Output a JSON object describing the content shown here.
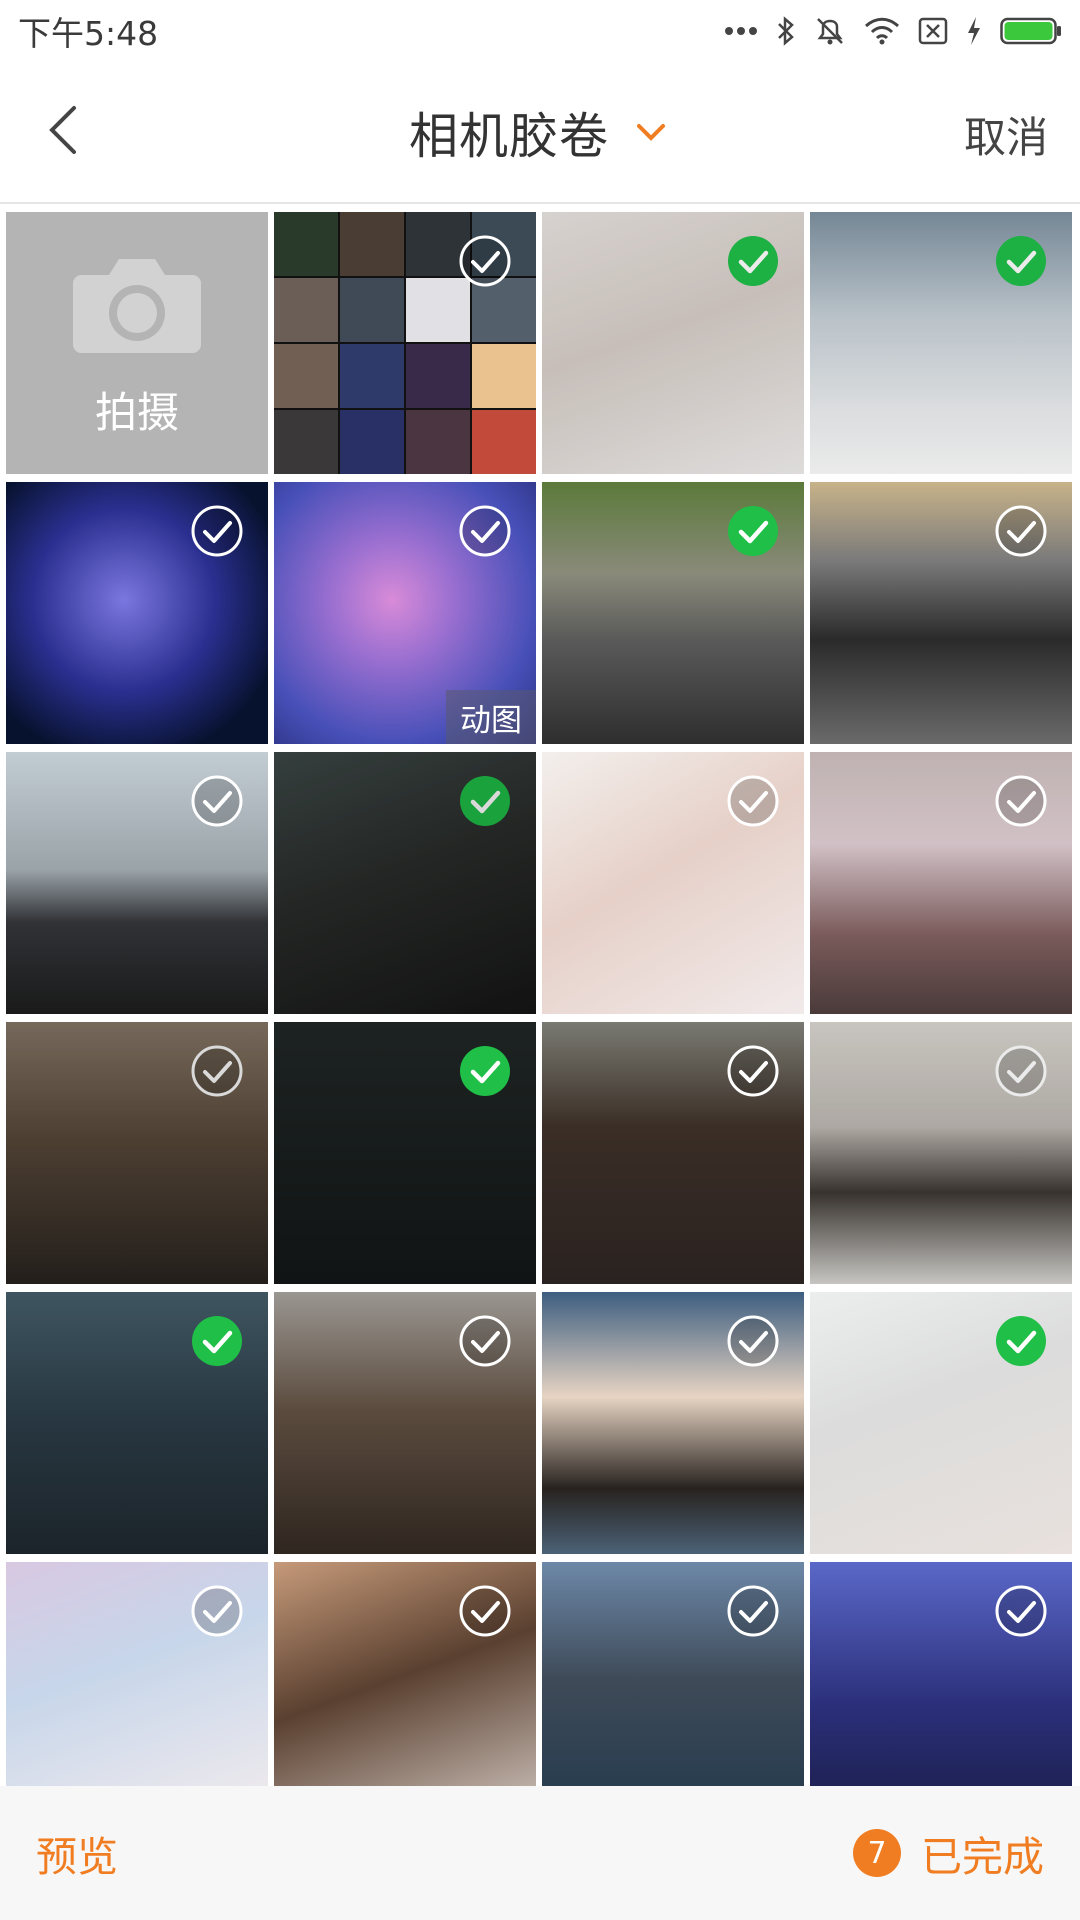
{
  "status_bar": {
    "time": "下午5:48",
    "battery_color": "#3cc83c"
  },
  "header": {
    "title": "相机胶卷",
    "cancel_label": "取消",
    "accent_color": "#f07d22"
  },
  "camera_tile": {
    "label": "拍摄",
    "icon": "camera-icon"
  },
  "photos": [
    {
      "checked": false,
      "collage": true,
      "gif": ""
    },
    {
      "checked": true,
      "gif": ""
    },
    {
      "checked": true,
      "gif": ""
    },
    {
      "checked": false,
      "gif": ""
    },
    {
      "checked": false,
      "gif": "动图"
    },
    {
      "checked": true,
      "gif": ""
    },
    {
      "checked": false,
      "gif": ""
    },
    {
      "checked": false,
      "gif": ""
    },
    {
      "checked": true,
      "gif": ""
    },
    {
      "checked": false,
      "gif": ""
    },
    {
      "checked": false,
      "gif": ""
    },
    {
      "checked": false,
      "gif": ""
    },
    {
      "checked": true,
      "gif": ""
    },
    {
      "checked": false,
      "gif": ""
    },
    {
      "checked": false,
      "gif": ""
    },
    {
      "checked": true,
      "gif": ""
    },
    {
      "checked": false,
      "gif": ""
    },
    {
      "checked": false,
      "gif": ""
    },
    {
      "checked": true,
      "gif": ""
    },
    {
      "checked": false,
      "gif": ""
    },
    {
      "checked": false,
      "gif": ""
    },
    {
      "checked": false,
      "gif": ""
    },
    {
      "checked": false,
      "gif": ""
    }
  ],
  "footer": {
    "preview_label": "预览",
    "selected_count": "7",
    "done_label": "已完成"
  },
  "colors": {
    "check_green": "#1fbf48",
    "camera_tile_bg": "#b4b4b4"
  }
}
